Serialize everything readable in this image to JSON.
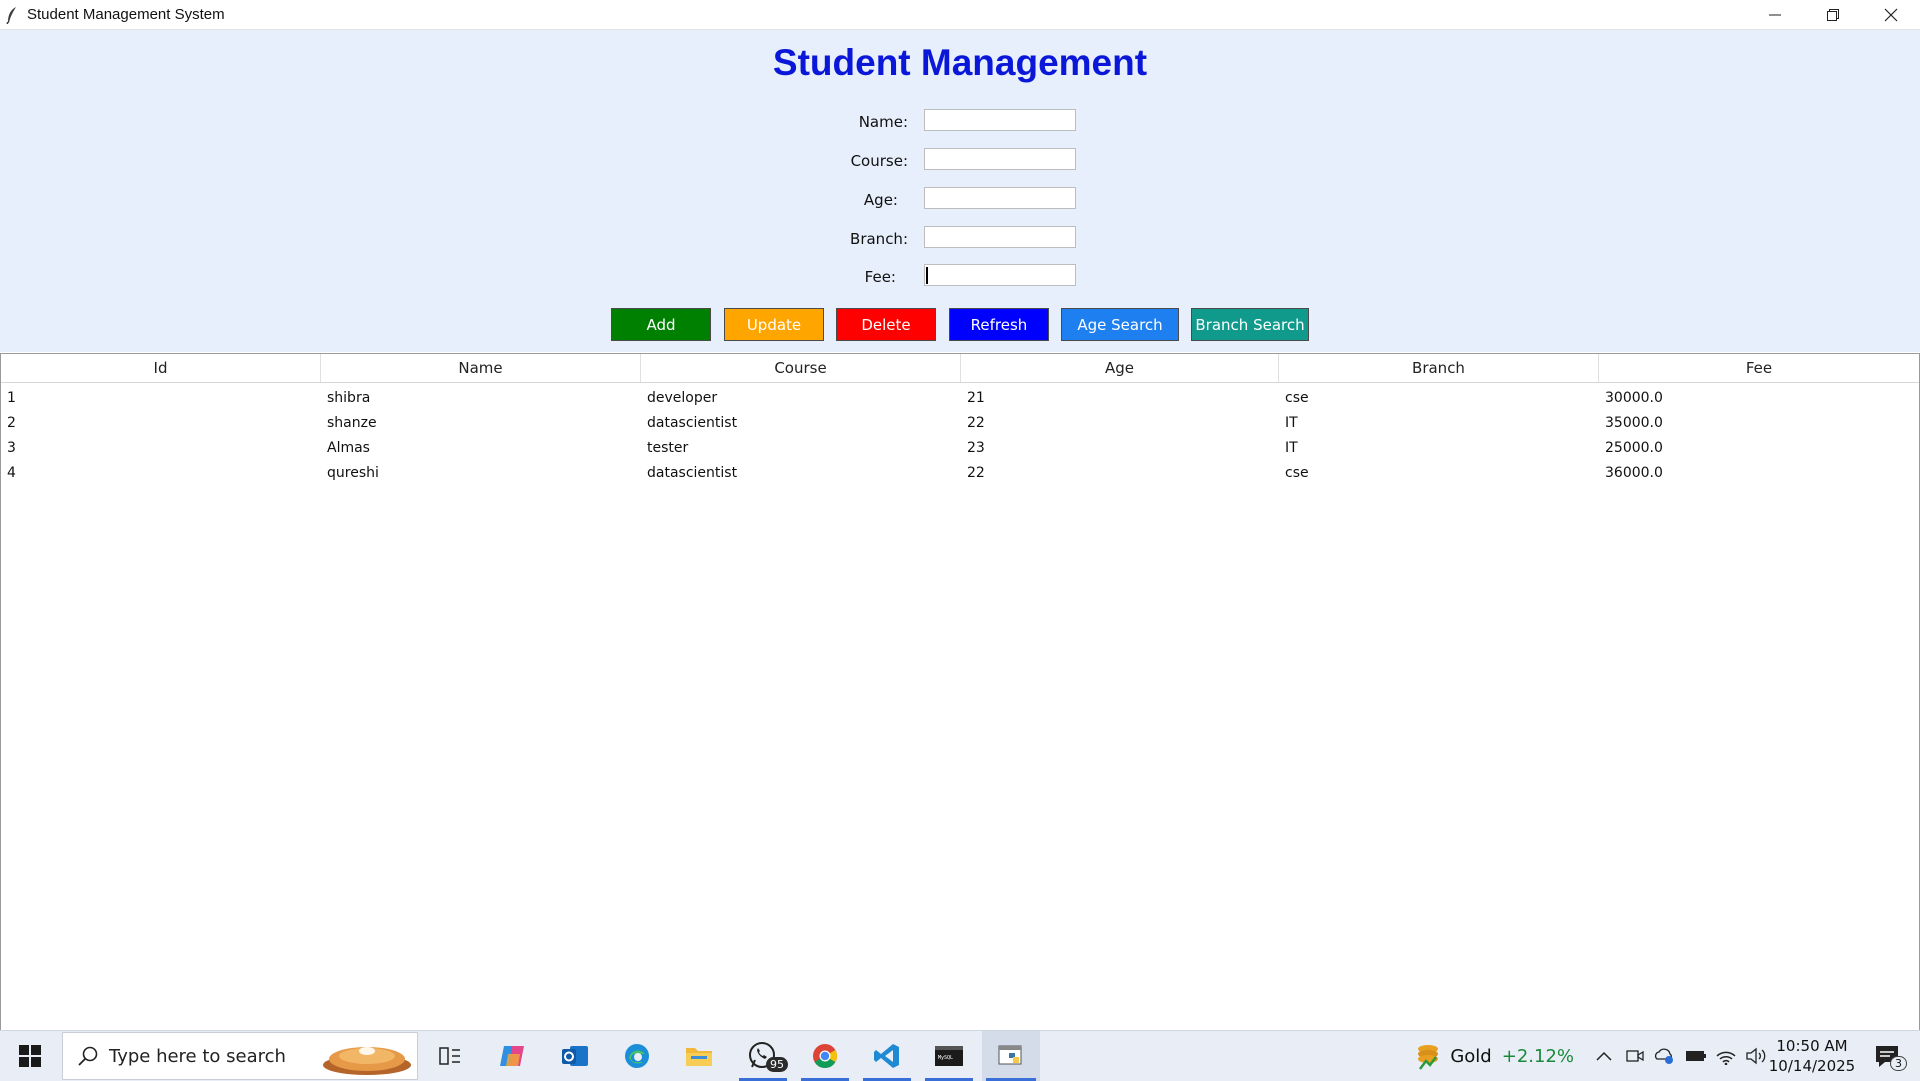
{
  "window": {
    "title": "Student Management System",
    "icon": "feather-icon",
    "controls": [
      "minimize-icon",
      "restore-icon",
      "close-icon"
    ]
  },
  "header": {
    "title": "Student Management"
  },
  "form": {
    "fields": [
      {
        "label": "Name:",
        "value": ""
      },
      {
        "label": "Course:",
        "value": ""
      },
      {
        "label": "Age:",
        "value": ""
      },
      {
        "label": "Branch:",
        "value": ""
      },
      {
        "label": "Fee:",
        "value": ""
      }
    ]
  },
  "buttons": [
    {
      "label": "Add",
      "color": "#008000"
    },
    {
      "label": "Update",
      "color": "#ffa500"
    },
    {
      "label": "Delete",
      "color": "#ff0000"
    },
    {
      "label": "Refresh",
      "color": "#0000ff"
    },
    {
      "label": "Age Search",
      "color": "#1e7ff0"
    },
    {
      "label": "Branch Search",
      "color": "#0f9a8c"
    }
  ],
  "table": {
    "columns": [
      "Id",
      "Name",
      "Course",
      "Age",
      "Branch",
      "Fee"
    ],
    "rows": [
      [
        "1",
        "shibra",
        "developer",
        "21",
        "cse",
        "30000.0"
      ],
      [
        "2",
        "shanze",
        "datascientist",
        "22",
        "IT",
        "35000.0"
      ],
      [
        "3",
        "Almas",
        "tester",
        "23",
        "IT",
        "25000.0"
      ],
      [
        "4",
        "qureshi",
        "datascientist",
        "22",
        "cse",
        "36000.0"
      ]
    ]
  },
  "taskbar": {
    "search_placeholder": "Type here to search",
    "whatsapp_badge": "95",
    "apps": [
      "windows-start-icon",
      "task-view-icon",
      "copilot-icon",
      "outlook-icon",
      "edge-icon",
      "file-explorer-icon",
      "whatsapp-icon",
      "chrome-icon",
      "vscode-icon",
      "mysql-terminal-icon",
      "python-app-icon"
    ],
    "widget": {
      "label": "Gold",
      "change": "+2.12%",
      "change_color": "#1a8a3a"
    },
    "clock": {
      "time": "10:50 AM",
      "date": "10/14/2025"
    },
    "notification_count": "3"
  }
}
